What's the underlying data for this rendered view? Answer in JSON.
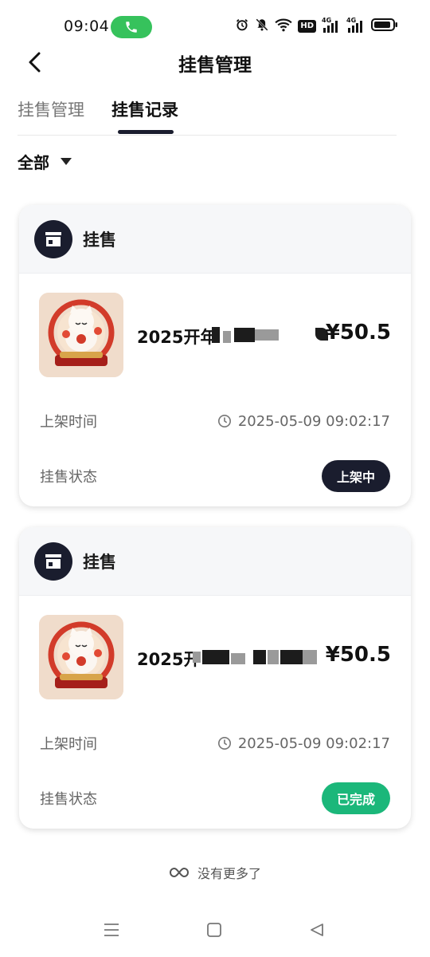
{
  "status_bar": {
    "time": "09:04",
    "icons": [
      "alarm-icon",
      "mute-icon",
      "wifi-icon",
      "hd-icon",
      "signal-4g-icon",
      "signal-4g-icon",
      "battery-icon"
    ],
    "hd_label": "HD",
    "net_label_1": "4G",
    "net_label_2": "4G",
    "call_color": "#36c25c"
  },
  "header": {
    "title": "挂售管理",
    "back_icon": "chevron-left-icon"
  },
  "tabs": [
    {
      "label": "挂售管理",
      "active": false
    },
    {
      "label": "挂售记录",
      "active": true
    }
  ],
  "filter": {
    "label": "全部",
    "icon": "caret-down-icon"
  },
  "records": [
    {
      "section_label": "挂售",
      "section_icon": "store-icon",
      "product_name_visible": "2025开年",
      "price": "¥50.5",
      "listing_time_label": "上架时间",
      "listing_time": "2025-05-09 09:02:17",
      "status_label": "挂售状态",
      "status": "上架中",
      "status_color": "#1a1d2e"
    },
    {
      "section_label": "挂售",
      "section_icon": "store-icon",
      "product_name_visible": "2025开",
      "price": "¥50.5",
      "listing_time_label": "上架时间",
      "listing_time": "2025-05-09 09:02:17",
      "status_label": "挂售状态",
      "status": "已完成",
      "status_color": "#1bb77a"
    }
  ],
  "footer": {
    "no_more": "没有更多了",
    "icon": "infinity-icon"
  },
  "nav_bar": {
    "icons": [
      "menu-icon",
      "home-icon",
      "back-triangle-icon"
    ]
  },
  "colors": {
    "accent_dark": "#1a1d2e",
    "success_green": "#1bb77a",
    "muted_text": "#666666"
  }
}
